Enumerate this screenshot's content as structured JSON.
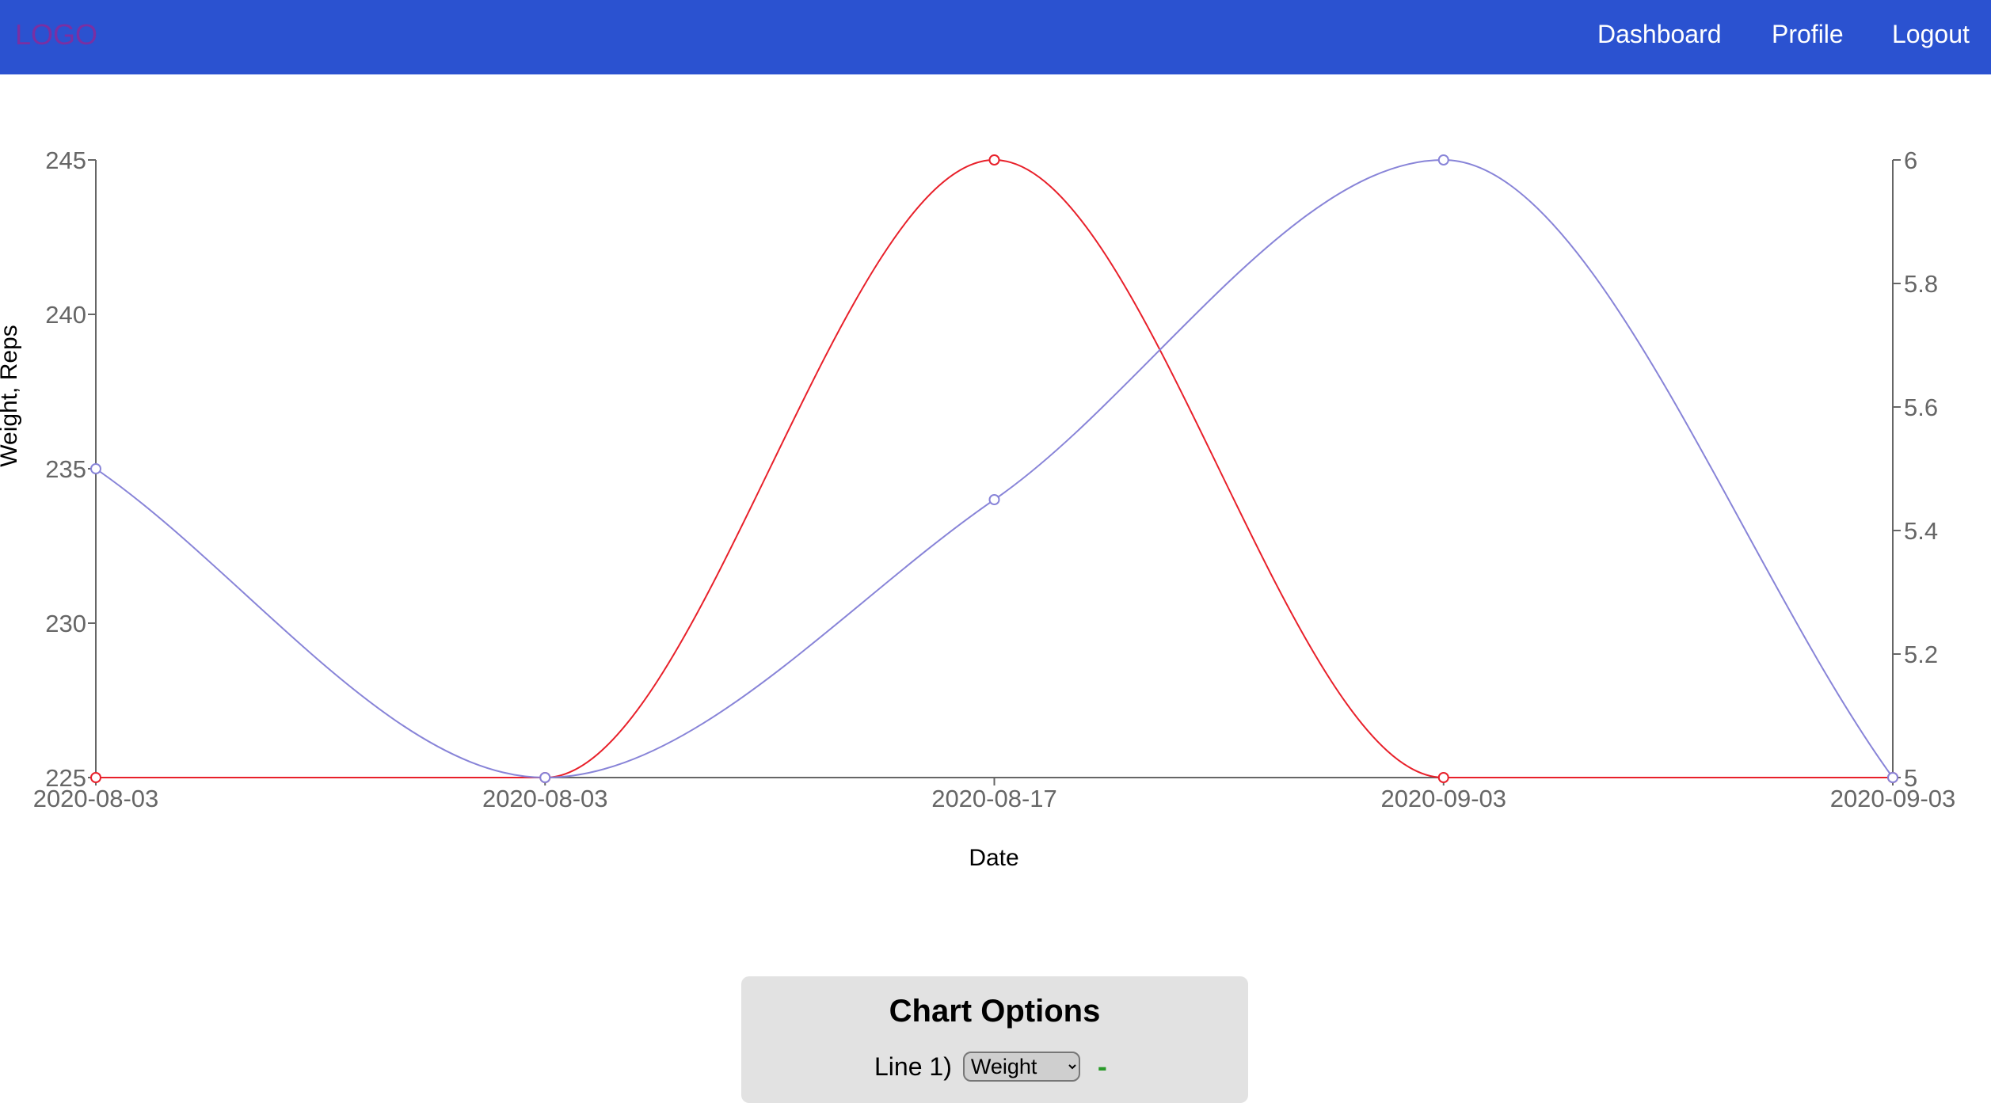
{
  "nav": {
    "logo": "LOGO",
    "links": [
      "Dashboard",
      "Profile",
      "Logout"
    ]
  },
  "colors": {
    "navbar": "#2b52d0",
    "logo": "#7a2fa3",
    "weight_line": "#e8202a",
    "reps_line": "#8884d8"
  },
  "chart_data": {
    "type": "line",
    "categories": [
      "2020-08-03",
      "2020-08-03",
      "2020-08-17",
      "2020-09-03",
      "2020-09-03"
    ],
    "xlabel": "Date",
    "ylabel": "Weight, Reps",
    "y_left": {
      "ticks": [
        225,
        230,
        235,
        240,
        245
      ],
      "range": [
        225,
        245
      ]
    },
    "y_right": {
      "ticks": [
        5,
        5.2,
        5.4,
        5.6,
        5.8,
        6
      ],
      "range": [
        5,
        6
      ]
    },
    "curve": "monotone",
    "grid": false,
    "series": [
      {
        "axis": "left",
        "color": "#e8202a",
        "values": [
          225,
          225,
          245,
          225,
          225
        ]
      },
      {
        "axis": "right",
        "color": "#8884d8",
        "values": [
          5.5,
          5,
          5.45,
          6,
          5
        ]
      }
    ]
  },
  "options": {
    "title": "Chart Options",
    "line_label": "Line 1)",
    "select_value": "Weight",
    "select_options": [
      "Weight"
    ],
    "remove_symbol": "-"
  }
}
